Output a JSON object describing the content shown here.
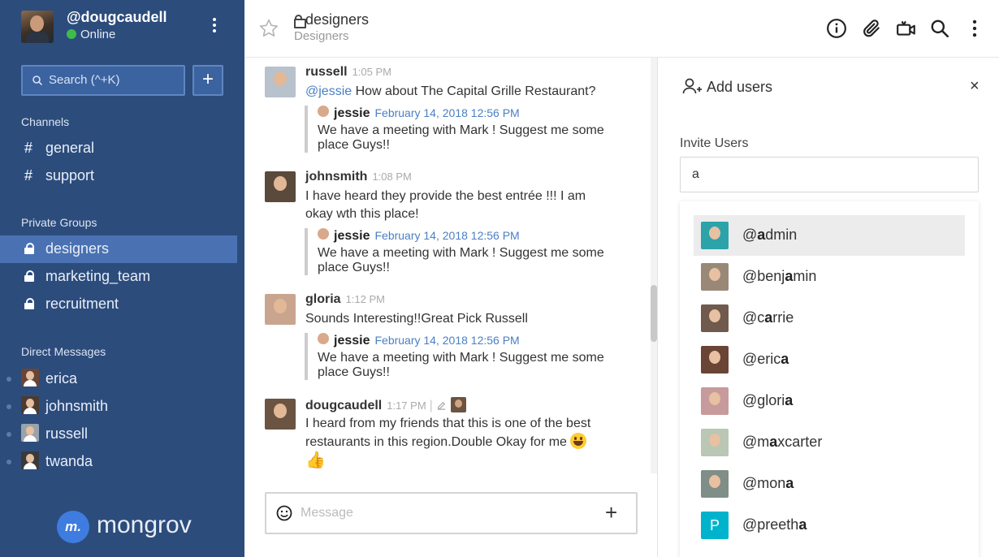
{
  "user": {
    "name": "@dougcaudell",
    "status": "Online"
  },
  "sidebar": {
    "search_label": "Search (^+K)",
    "add_label": "+",
    "channels_title": "Channels",
    "channels": [
      {
        "label": "general"
      },
      {
        "label": "support"
      }
    ],
    "groups_title": "Private Groups",
    "groups": [
      {
        "label": "designers",
        "active": true
      },
      {
        "label": "marketing_team"
      },
      {
        "label": "recruitment"
      }
    ],
    "dm_title": "Direct Messages",
    "dms": [
      {
        "label": "erica"
      },
      {
        "label": "johnsmith"
      },
      {
        "label": "russell"
      },
      {
        "label": "twanda"
      }
    ],
    "logo_badge": "m.",
    "logo_text": "mongrov"
  },
  "header": {
    "title": "designers",
    "subtitle": "Designers"
  },
  "messages": [
    {
      "name": "russell",
      "time": "1:05 PM",
      "mention": "@jessie",
      "text": " How about The Capital Grille Restaurant?",
      "quote": {
        "name": "jessie",
        "date": "February 14, 2018 12:56 PM",
        "text": "We have a meeting with Mark ! Suggest me some place Guys!!"
      }
    },
    {
      "name": "johnsmith",
      "time": "1:08 PM",
      "text": "I have heard they provide the best entrée !!! I am okay wth this place!",
      "quote": {
        "name": "jessie",
        "date": "February 14, 2018 12:56 PM",
        "text": "We have a meeting with Mark ! Suggest me some place Guys!!"
      }
    },
    {
      "name": "gloria",
      "time": "1:12 PM",
      "text": "Sounds Interesting!!Great Pick Russell",
      "quote": {
        "name": "jessie",
        "date": "February 14, 2018 12:56 PM",
        "text": "We have a meeting with Mark ! Suggest me some place Guys!!"
      }
    },
    {
      "name": "dougcaudell",
      "time": "1:17 PM",
      "text": "I heard from my friends that this is one of the best restaurants in this region.Double Okay for me"
    }
  ],
  "composer": {
    "placeholder": "Message"
  },
  "panel": {
    "title": "Add users",
    "close": "×",
    "invite_label": "Invite Users",
    "invite_value": "a",
    "suggestions": [
      {
        "pre": "@",
        "match": "a",
        "post": "dmin",
        "highlighted": true
      },
      {
        "pre": "@benj",
        "match": "a",
        "post": "min"
      },
      {
        "pre": "@c",
        "match": "a",
        "post": "rrie"
      },
      {
        "pre": "@eric",
        "match": "a",
        "post": ""
      },
      {
        "pre": "@glori",
        "match": "a",
        "post": ""
      },
      {
        "pre": "@m",
        "match": "a",
        "post": "xcarter"
      },
      {
        "pre": "@mon",
        "match": "a",
        "post": ""
      },
      {
        "pre": "@preeth",
        "match": "a",
        "post": "",
        "letter": "P"
      }
    ]
  },
  "colors": {
    "sidebar": "#2c4c7c",
    "active": "#4a72b3",
    "accent": "#4a7fc4",
    "online": "#3fbb4c",
    "letter_avatar": "#00b3cc"
  },
  "icons": [
    "kebab-menu-icon",
    "search-icon",
    "lock-icon",
    "star-icon",
    "info-icon",
    "paperclip-icon",
    "video-icon",
    "smile-icon",
    "thumbs-up-icon",
    "add-user-icon",
    "pencil-icon"
  ]
}
